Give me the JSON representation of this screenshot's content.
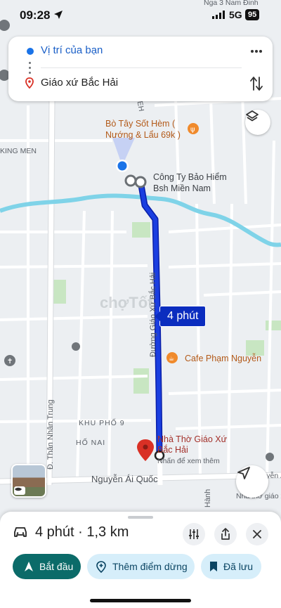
{
  "status_bar": {
    "time": "09:28",
    "network": "5G",
    "battery": "95"
  },
  "route_card": {
    "origin": "Vị trí của bạn",
    "destination": "Giáo xứ Bắc Hải"
  },
  "map": {
    "labels": {
      "nga3": "Nga 3 Nam Đinh",
      "bo_tay_1": "Bò Tây Sốt Hèm (",
      "bo_tay_2": "Nướng & Lẩu 69k )",
      "king_men": "KING MEN",
      "cong_ty_1": "Công Ty Bảo Hiểm",
      "cong_ty_2": "Bsh Miền Nam",
      "cafe": "Cafe Phạm Nguyễn",
      "khu_pho": "KHU PHỐ 9",
      "ho_nai": "HỐ NAI",
      "nha_tho_1": "Nhà Thờ Giáo Xứ",
      "nha_tho_2": "Bắc Hải",
      "nhan_de_xem": "Nhấn để xem thêm",
      "nguyen_ai_quoc": "Nguyễn Ái Quốc",
      "nha_tho_gia": "Nhà thờ giáo x",
      "nguyen_an": "Nguyễn Ái",
      "than_nhan_trung": "Đ. Thân Nhân Trung",
      "duong_giao_xu": "Đường Giáo Xứ Bắc Hải",
      "hanh": "Hành",
      "ieh": "IEH"
    },
    "route_time_badge": "4 phút",
    "watermark": "chợTốt"
  },
  "sheet": {
    "summary": "4 phút · 1,3 km",
    "start_label": "Bắt đầu",
    "add_stop_label": "Thêm điểm dừng",
    "saved_label": "Đã lưu"
  },
  "colors": {
    "route": "#1a3ee0",
    "start_button": "#0b6b69",
    "pill_button": "#d6eefa",
    "river": "#7fd3e8",
    "destination_pin": "#d93025"
  },
  "icons": [
    "location-arrow-icon",
    "signal-icon",
    "more-icon",
    "swap-icon",
    "pin-icon",
    "layers-icon",
    "recenter-icon",
    "car-icon",
    "filter-icon",
    "share-icon",
    "close-icon",
    "navigation-icon",
    "add-stop-icon",
    "bookmark-icon",
    "fork-knife-icon",
    "coffee-icon",
    "church-icon",
    "bus-icon",
    "street-view-icon"
  ]
}
